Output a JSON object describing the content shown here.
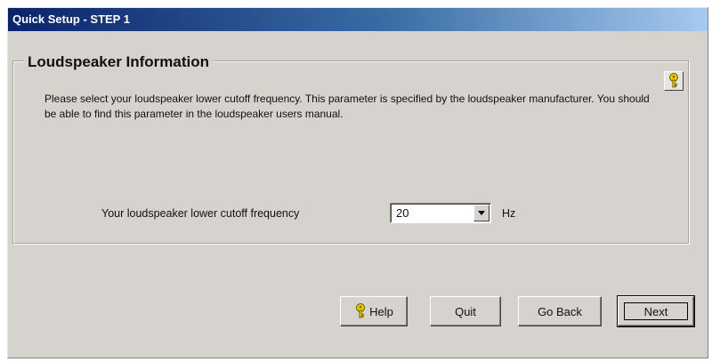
{
  "window": {
    "title": "Quick Setup - STEP 1"
  },
  "group": {
    "title": "Loudspeaker Information",
    "description": "Please select your loudspeaker lower cutoff frequency. This parameter is specified by the loudspeaker manufacturer. You should be able to find this parameter in the loudspeaker users manual.",
    "help_icon": "question-key-icon"
  },
  "frequency": {
    "label": "Your loudspeaker lower cutoff frequency",
    "value": "20",
    "unit": "Hz"
  },
  "buttons": {
    "help": "Help",
    "quit": "Quit",
    "go_back": "Go Back",
    "next": "Next"
  },
  "colors": {
    "title_start": "#0a246a",
    "title_end": "#a6caf0",
    "face": "#d6d3ce",
    "help_icon": "#e8c800"
  }
}
